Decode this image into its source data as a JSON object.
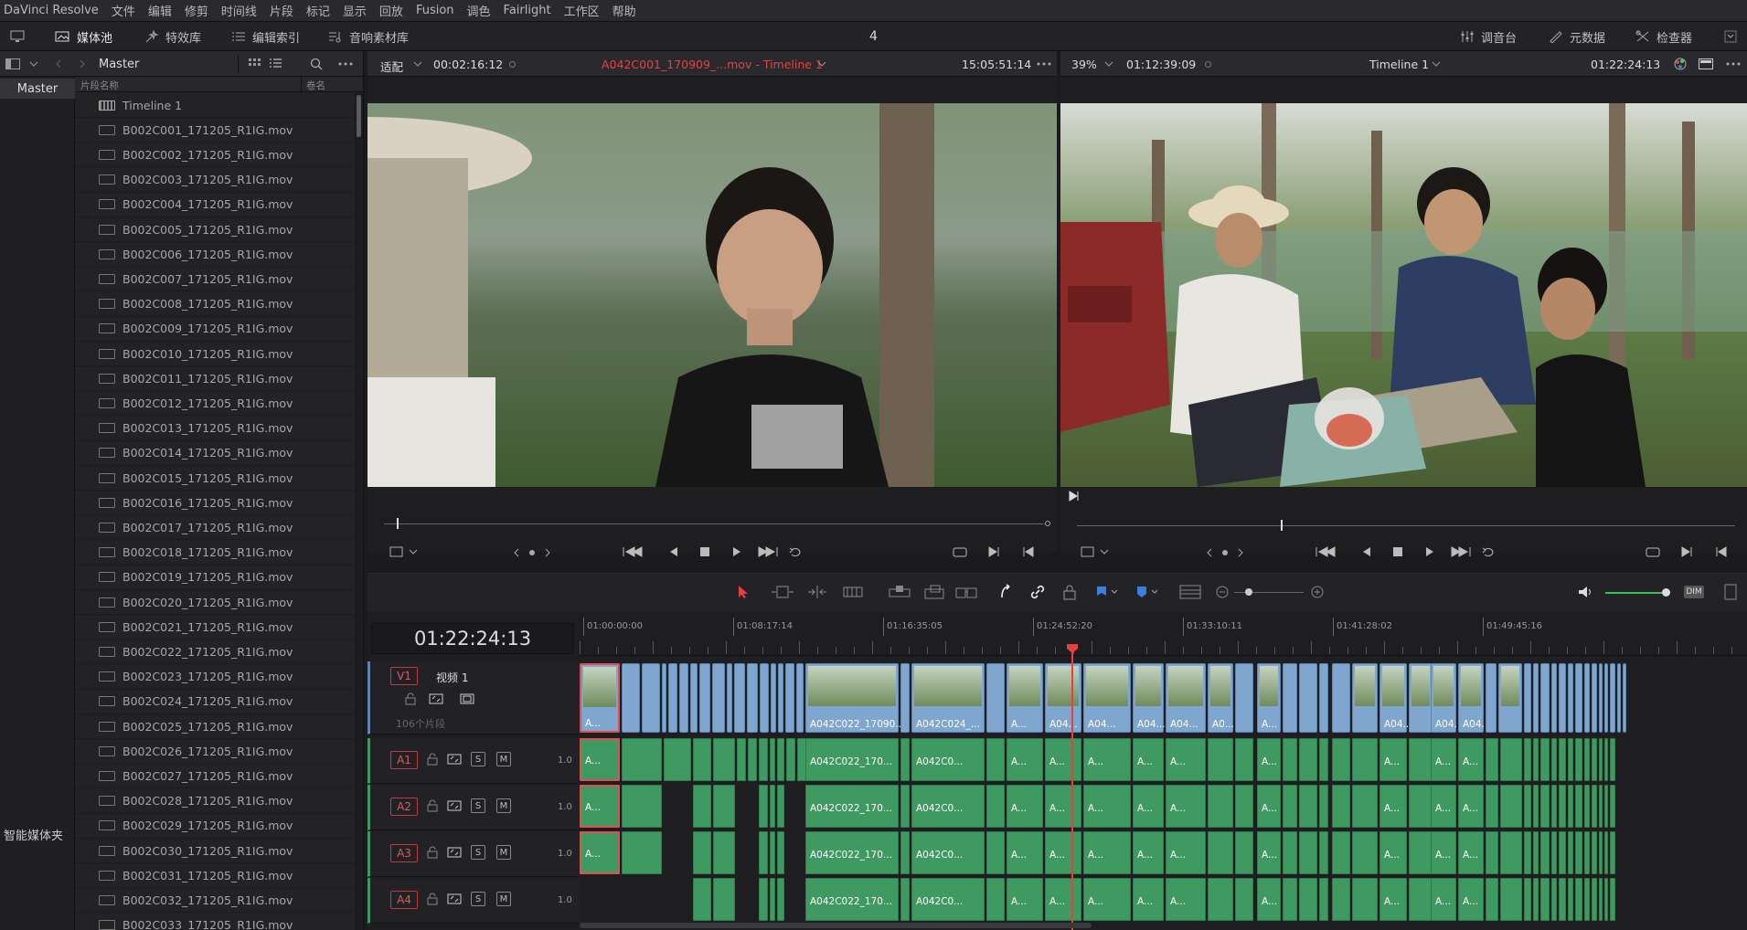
{
  "menu": [
    "DaVinci Resolve",
    "文件",
    "编辑",
    "修剪",
    "时间线",
    "片段",
    "标记",
    "显示",
    "回放",
    "Fusion",
    "调色",
    "Fairlight",
    "工作区",
    "帮助"
  ],
  "toolbar": {
    "media_pool": "媒体池",
    "effects": "特效库",
    "edit_index": "编辑索引",
    "sound_library": "音响素材库",
    "center_number": "4",
    "mixer": "调音台",
    "metadata": "元数据",
    "inspector": "检查器"
  },
  "bins": {
    "master": "Master",
    "smart_bins": "智能媒体夹"
  },
  "media_pool": {
    "title": "Master",
    "col_name": "片段名称",
    "col_reel": "卷名",
    "items": [
      "Timeline 1",
      "B002C001_171205_R1IG.mov",
      "B002C002_171205_R1IG.mov",
      "B002C003_171205_R1IG.mov",
      "B002C004_171205_R1IG.mov",
      "B002C005_171205_R1IG.mov",
      "B002C006_171205_R1IG.mov",
      "B002C007_171205_R1IG.mov",
      "B002C008_171205_R1IG.mov",
      "B002C009_171205_R1IG.mov",
      "B002C010_171205_R1IG.mov",
      "B002C011_171205_R1IG.mov",
      "B002C012_171205_R1IG.mov",
      "B002C013_171205_R1IG.mov",
      "B002C014_171205_R1IG.mov",
      "B002C015_171205_R1IG.mov",
      "B002C016_171205_R1IG.mov",
      "B002C017_171205_R1IG.mov",
      "B002C018_171205_R1IG.mov",
      "B002C019_171205_R1IG.mov",
      "B002C020_171205_R1IG.mov",
      "B002C021_171205_R1IG.mov",
      "B002C022_171205_R1IG.mov",
      "B002C023_171205_R1IG.mov",
      "B002C024_171205_R1IG.mov",
      "B002C025_171205_R1IG.mov",
      "B002C026_171205_R1IG.mov",
      "B002C027_171205_R1IG.mov",
      "B002C028_171205_R1IG.mov",
      "B002C029_171205_R1IG.mov",
      "B002C030_171205_R1IG.mov",
      "B002C031_171205_R1IG.mov",
      "B002C032_171205_R1IG.mov",
      "B002C033_171205_R1IG.mov"
    ]
  },
  "source_viewer": {
    "fit": "适配",
    "duration": "00:02:16:12",
    "clip_title": "A042C001_170909_...mov - Timeline 1",
    "timecode": "15:05:51:14",
    "progress": 0.02
  },
  "timeline_viewer": {
    "zoom": "39%",
    "duration": "01:12:39:09",
    "title": "Timeline 1",
    "timecode": "01:22:24:13",
    "progress": 0.31
  },
  "timeline": {
    "timecode": "01:22:24:13",
    "ruler": [
      "01:00:00:00",
      "01:08:17:14",
      "01:16:35:05",
      "01:24:52:20",
      "01:33:10:11",
      "01:41:28:02",
      "01:49:45:16"
    ],
    "video_track": {
      "id": "V1",
      "name": "视频 1",
      "clip_count": "106个片段"
    },
    "audio_tracks": [
      {
        "id": "A1",
        "level": "1.0"
      },
      {
        "id": "A2",
        "level": "1.0"
      },
      {
        "id": "A3",
        "level": "1.0"
      },
      {
        "id": "A4",
        "level": "1.0"
      }
    ],
    "solo": "S",
    "mute": "M",
    "clip_labels": {
      "first": "A...",
      "a042c022": "A042C022_17090...",
      "a042c024": "A042C024_...",
      "a04": "A04...",
      "a0": "A0...",
      "a": "A...",
      "audio_a042c022": "A042C022_170...",
      "audio_a042c0": "A042C0..."
    }
  },
  "dim_label": "DIM",
  "colors": {
    "accent_red": "#e84040",
    "video_clip": "#7ea6cf",
    "audio_clip": "#3f9a62",
    "selected": "#e05050"
  }
}
